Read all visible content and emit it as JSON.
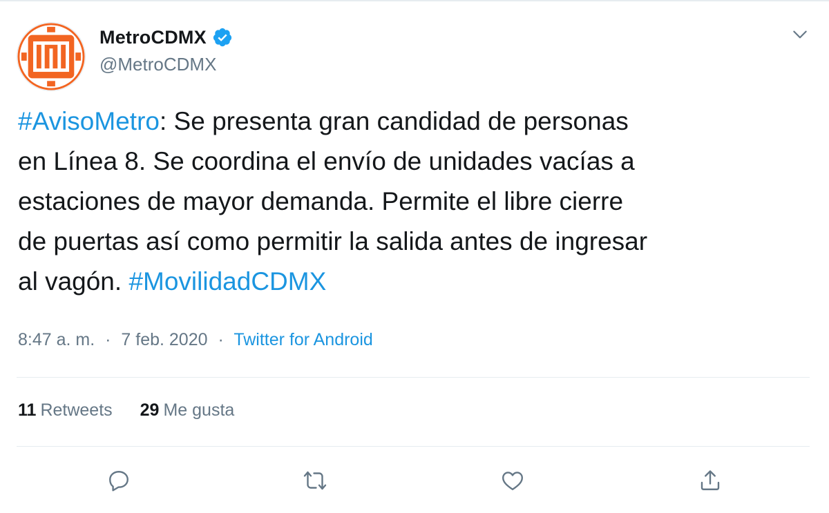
{
  "account": {
    "display_name": "MetroCDMX",
    "handle": "@MetroCDMX",
    "brand_color": "#f26522",
    "verified": true
  },
  "tweet": {
    "lines": [
      [
        {
          "text": "#AvisoMetro",
          "hashtag": true
        },
        {
          "text": ": Se presenta gran candidad de personas",
          "hashtag": false
        }
      ],
      [
        {
          "text": "en Línea 8. Se coordina el envío de unidades vacías a",
          "hashtag": false
        }
      ],
      [
        {
          "text": "estaciones de mayor demanda. Permite el libre cierre",
          "hashtag": false
        }
      ],
      [
        {
          "text": "de puertas así como permitir la salida antes de ingresar",
          "hashtag": false
        }
      ],
      [
        {
          "text": "al vagón. ",
          "hashtag": false
        },
        {
          "text": "#MovilidadCDMX",
          "hashtag": true
        }
      ]
    ],
    "time": "8:47 a. m.",
    "separator": "·",
    "date": "7 feb. 2020",
    "source": "Twitter for Android"
  },
  "stats": {
    "retweets_count": "11",
    "retweets_label": "Retweets",
    "likes_count": "29",
    "likes_label": "Me gusta"
  },
  "icons": {
    "reply": "reply-icon",
    "retweet": "retweet-icon",
    "like": "heart-icon",
    "share": "share-icon",
    "menu": "chevron-down-icon",
    "verified": "verified-badge-icon"
  },
  "colors": {
    "link": "#1b95e0",
    "secondary_text": "#657786",
    "primary_text": "#14171a",
    "verified": "#1da1f2"
  }
}
